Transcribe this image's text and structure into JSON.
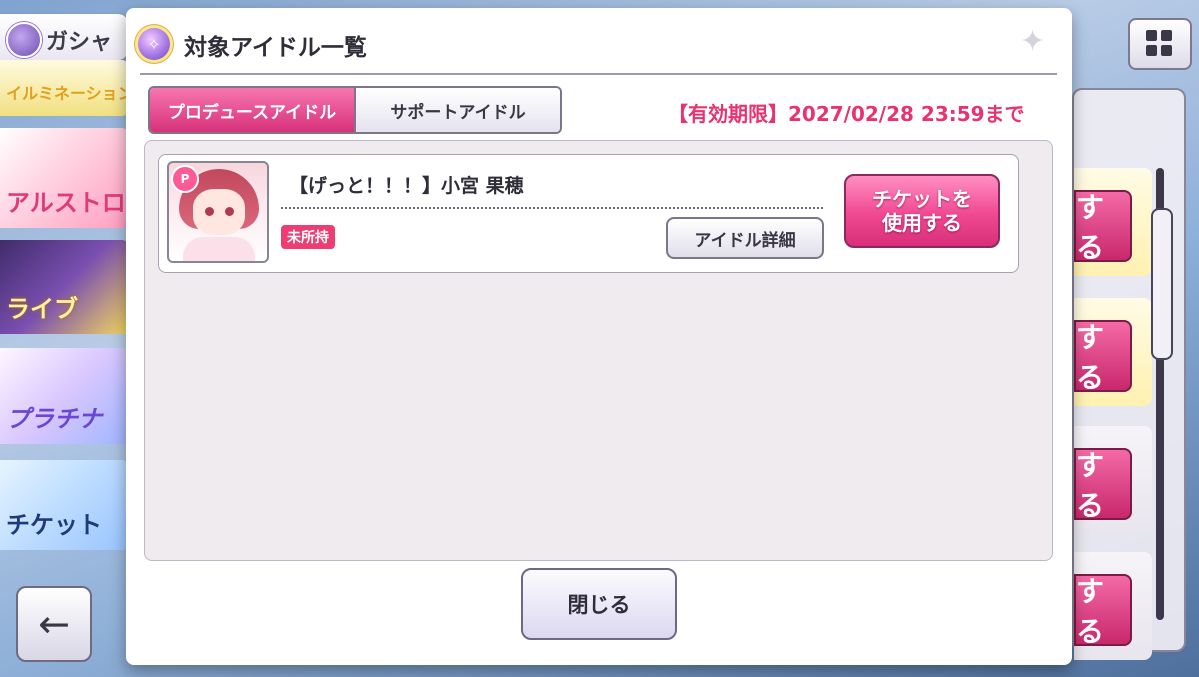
{
  "background": {
    "header_title": "ガシャ",
    "banners": [
      "イルミネーション",
      "アルストロメリア",
      "ライブ",
      "プラチナ",
      "チケット"
    ],
    "side_button_text": "する"
  },
  "modal": {
    "title": "対象アイドル一覧",
    "tabs": [
      {
        "label": "プロデュースアイドル",
        "active": true
      },
      {
        "label": "サポートアイドル",
        "active": false
      }
    ],
    "deadline": "【有効期限】2027/02/28 23:59まで",
    "items": [
      {
        "type_badge": "P",
        "name": "【げっと！！！】小宮 果穂",
        "status": "未所持",
        "detail_button": "アイドル詳細",
        "use_button_line1": "チケットを",
        "use_button_line2": "使用する"
      }
    ],
    "close_button": "閉じる"
  },
  "icons": {
    "back": "←",
    "sparkle": "✦"
  }
}
